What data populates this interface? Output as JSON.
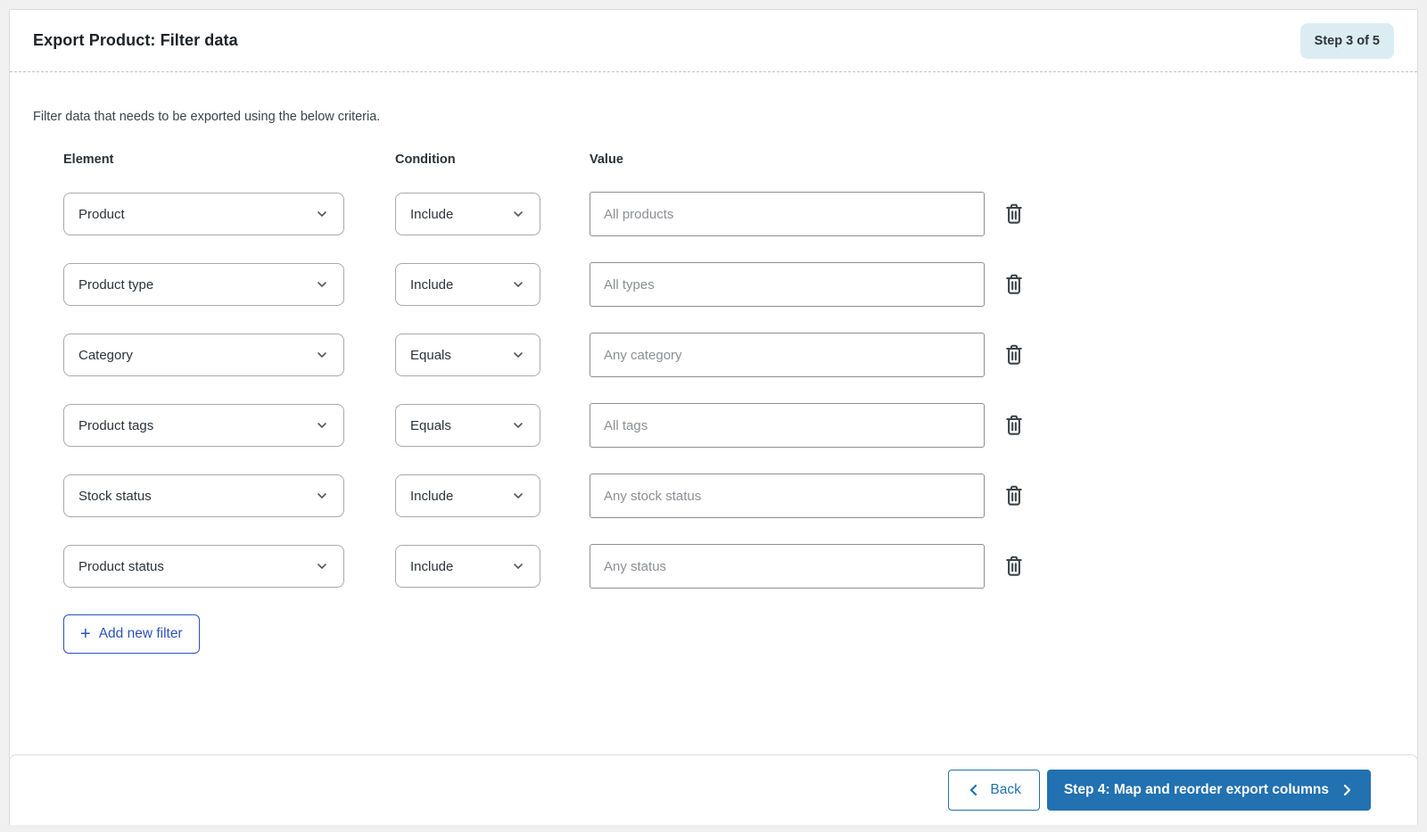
{
  "header": {
    "title": "Export Product: Filter data",
    "step_badge": "Step 3 of 5"
  },
  "intro": "Filter data that needs to be exported using the below criteria.",
  "columns": {
    "element": "Element",
    "condition": "Condition",
    "value": "Value"
  },
  "filters": [
    {
      "element": "Product",
      "condition": "Include",
      "value_placeholder": "All products"
    },
    {
      "element": "Product type",
      "condition": "Include",
      "value_placeholder": "All types"
    },
    {
      "element": "Category",
      "condition": "Equals",
      "value_placeholder": "Any category"
    },
    {
      "element": "Product tags",
      "condition": "Equals",
      "value_placeholder": "All tags"
    },
    {
      "element": "Stock status",
      "condition": "Include",
      "value_placeholder": "Any stock status"
    },
    {
      "element": "Product status",
      "condition": "Include",
      "value_placeholder": "Any status"
    }
  ],
  "add_filter": {
    "plus": "+",
    "label": "Add new filter"
  },
  "footer": {
    "back_label": "Back",
    "next_label": "Step 4: Map and reorder export columns"
  },
  "icons": {
    "trash": "trash-can-outline",
    "chevron_down": "select-dropdown-arrow",
    "chevron_left": "back-arrow",
    "chevron_right": "forward-arrow"
  },
  "colors": {
    "primary_blue": "#2271b1",
    "add_filter_blue": "#2a52be",
    "badge_bg": "#dcecf3",
    "page_bg": "#f0f0f1",
    "border_gray": "#dcdcde",
    "placeholder_gray": "#8c8f94",
    "icon_slate": "#3c434a"
  }
}
